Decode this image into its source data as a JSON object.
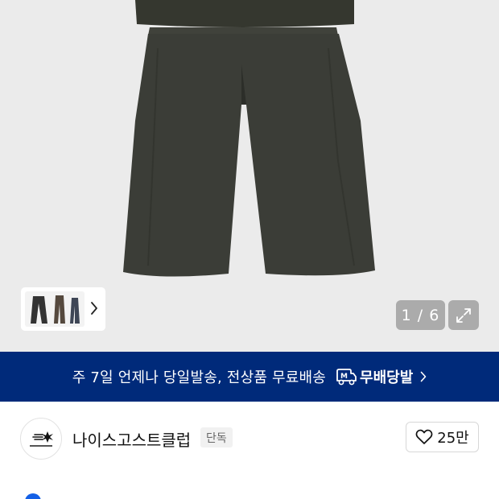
{
  "gallery": {
    "current_page": 1,
    "total_pages": 6,
    "counter_text": "1 / 6",
    "background_color": "#ebebeb",
    "product_color": "#3b3d37"
  },
  "thumbnails": {
    "count": 3,
    "more_icon": "chevron-right-icon"
  },
  "expand_icon": "expand-icon",
  "banner": {
    "text": "주 7일 언제나 당일발송, 전상품 무료배송",
    "free_delivery_label": "무배당발",
    "truck_icon": "truck-m-icon",
    "background_color": "#002a7a"
  },
  "brand": {
    "name": "나이스고스트클럽",
    "badge": "단독",
    "logo_icon": "brand-logo-icon"
  },
  "like": {
    "count": "25만",
    "icon": "heart-icon"
  }
}
